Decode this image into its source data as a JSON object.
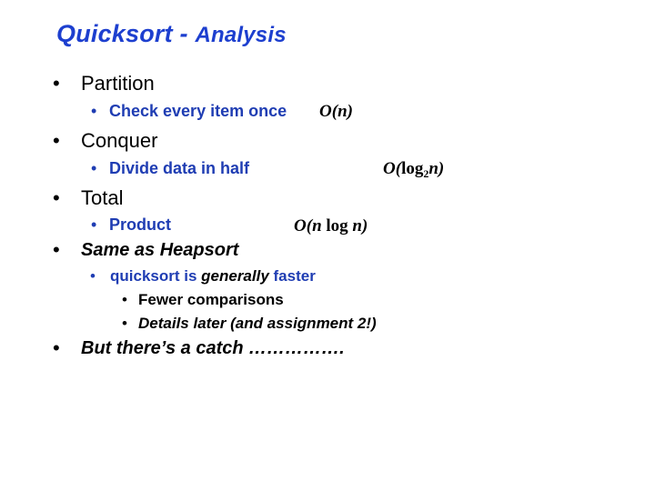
{
  "slide": {
    "title_main": "Quicksort",
    "title_sep": " - ",
    "title_sub": "Analysis",
    "bullets": {
      "partition": {
        "label": "Partition",
        "sub": "Check every item once",
        "complexity": {
          "O": "O(",
          "var": "n",
          "close": ")"
        }
      },
      "conquer": {
        "label": "Conquer",
        "sub": "Divide data in half",
        "complexity": {
          "O": "O(",
          "fn": "log",
          "base": "2",
          "var": "n",
          "close": ")"
        }
      },
      "total": {
        "label": "Total",
        "sub": "Product",
        "complexity": {
          "O": "O(",
          "var1": "n",
          "fn": " log ",
          "var2": "n",
          "close": ")"
        }
      },
      "same": {
        "label": "Same as Heapsort",
        "sub": {
          "part1": "quicksort is ",
          "part2": "generally",
          "part3": " faster"
        },
        "subsub": [
          "Fewer comparisons",
          "Details later (and assignment 2!)"
        ]
      },
      "catch": {
        "label": "But there’s a catch ……………."
      }
    },
    "bullet_char": "•"
  }
}
